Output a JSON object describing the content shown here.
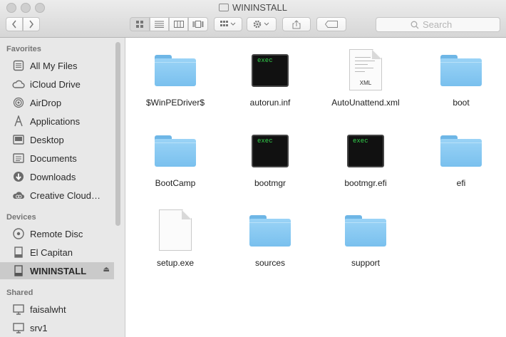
{
  "window": {
    "title": "WININSTALL"
  },
  "toolbar": {
    "search_placeholder": "Search"
  },
  "sidebar": {
    "sections": [
      {
        "title": "Favorites",
        "items": [
          {
            "label": "All My Files",
            "icon": "all-files-icon"
          },
          {
            "label": "iCloud Drive",
            "icon": "cloud-icon"
          },
          {
            "label": "AirDrop",
            "icon": "airdrop-icon"
          },
          {
            "label": "Applications",
            "icon": "applications-icon"
          },
          {
            "label": "Desktop",
            "icon": "desktop-icon"
          },
          {
            "label": "Documents",
            "icon": "documents-icon"
          },
          {
            "label": "Downloads",
            "icon": "downloads-icon"
          },
          {
            "label": "Creative Cloud…",
            "icon": "creative-cloud-icon"
          }
        ]
      },
      {
        "title": "Devices",
        "items": [
          {
            "label": "Remote Disc",
            "icon": "disc-icon"
          },
          {
            "label": "El Capitan",
            "icon": "drive-icon"
          },
          {
            "label": "WININSTALL",
            "icon": "drive-icon",
            "selected": true
          }
        ]
      },
      {
        "title": "Shared",
        "items": [
          {
            "label": "faisalwht",
            "icon": "computer-icon"
          },
          {
            "label": "srv1",
            "icon": "computer-icon"
          }
        ]
      }
    ]
  },
  "files": [
    {
      "name": "$WinPEDriver$",
      "kind": "folder"
    },
    {
      "name": "autorun.inf",
      "kind": "exec",
      "badge": "exec"
    },
    {
      "name": "AutoUnattend.xml",
      "kind": "xml",
      "badge": "XML"
    },
    {
      "name": "boot",
      "kind": "folder"
    },
    {
      "name": "BootCamp",
      "kind": "folder"
    },
    {
      "name": "bootmgr",
      "kind": "exec",
      "badge": "exec"
    },
    {
      "name": "bootmgr.efi",
      "kind": "exec",
      "badge": "exec"
    },
    {
      "name": "efi",
      "kind": "folder"
    },
    {
      "name": "setup.exe",
      "kind": "doc"
    },
    {
      "name": "sources",
      "kind": "folder"
    },
    {
      "name": "support",
      "kind": "folder"
    }
  ],
  "colors": {
    "folder": "#8ccbf3",
    "terminal_text": "#32d14b",
    "sidebar_bg": "#e8e8e8"
  }
}
